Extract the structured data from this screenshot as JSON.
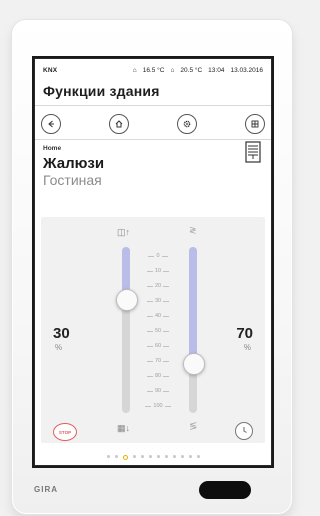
{
  "status": {
    "knx": "KNX",
    "temp1": "16.5 °C",
    "temp2": "20.5 °C",
    "time": "13:04",
    "date": "13.03.2016"
  },
  "header": {
    "title": "Функции здания"
  },
  "nav": {
    "buttons": [
      {
        "name": "back",
        "icon": "arrow-left-icon"
      },
      {
        "name": "home",
        "icon": "home-icon"
      },
      {
        "name": "settings",
        "icon": "gear-icon"
      },
      {
        "name": "grid",
        "icon": "grid-icon"
      }
    ]
  },
  "function": {
    "crumb": "Home",
    "title": "Жалюзи",
    "room": "Гостиная"
  },
  "left_control": {
    "value": "30",
    "unit": "%"
  },
  "right_control": {
    "value": "70",
    "unit": "%"
  },
  "scale": [
    "0",
    "10",
    "20",
    "30",
    "40",
    "50",
    "60",
    "70",
    "80",
    "90",
    "100"
  ],
  "buttons": {
    "stop_label": "STOP"
  },
  "pager": {
    "count": 12,
    "active": 2
  },
  "brand": "GIRA",
  "colors": {
    "accent": "#b9bde8",
    "stop": "#e06060"
  }
}
